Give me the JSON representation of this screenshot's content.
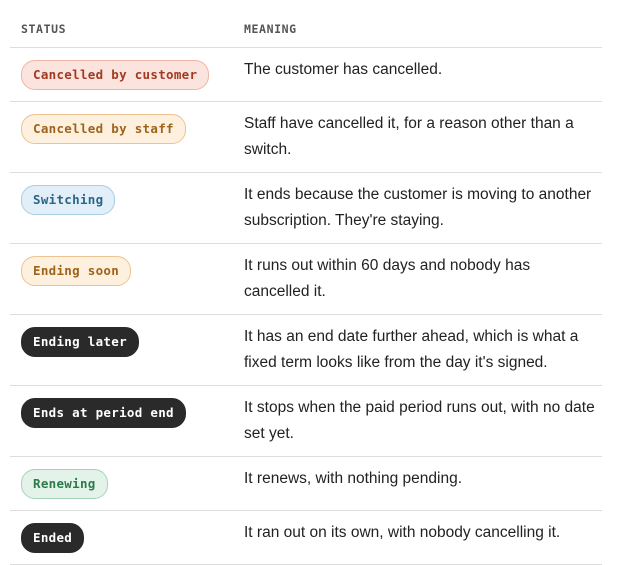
{
  "table": {
    "headers": {
      "status": "STATUS",
      "meaning": "MEANING"
    },
    "rows": [
      {
        "status": "Cancelled by customer",
        "style": "red",
        "meaning": "The customer has cancelled."
      },
      {
        "status": "Cancelled by staff",
        "style": "orange",
        "meaning": "Staff have cancelled it, for a reason other than a switch."
      },
      {
        "status": "Switching",
        "style": "blue",
        "meaning": "It ends because the customer is moving to another subscription. They're staying."
      },
      {
        "status": "Ending soon",
        "style": "orange",
        "meaning": "It runs out within 60 days and nobody has cancelled it."
      },
      {
        "status": "Ending later",
        "style": "dark",
        "meaning": "It has an end date further ahead, which is what a fixed term looks like from the day it's signed."
      },
      {
        "status": "Ends at period end",
        "style": "dark",
        "meaning": "It stops when the paid period runs out, with no date set yet."
      },
      {
        "status": "Renewing",
        "style": "green",
        "meaning": "It renews, with nothing pending."
      },
      {
        "status": "Ended",
        "style": "dark",
        "meaning": "It ran out on its own, with nobody cancelling it."
      }
    ]
  },
  "colors": {
    "red_bg": "#fce4de",
    "red_text": "#a23a22",
    "orange_bg": "#fdf0de",
    "orange_text": "#a0631a",
    "blue_bg": "#e2eff8",
    "blue_text": "#2b6587",
    "green_bg": "#e4f3ea",
    "green_text": "#2d7a4c",
    "dark_bg": "#2a2a2a",
    "dark_text": "#ffffff",
    "divider": "#dddddd"
  }
}
